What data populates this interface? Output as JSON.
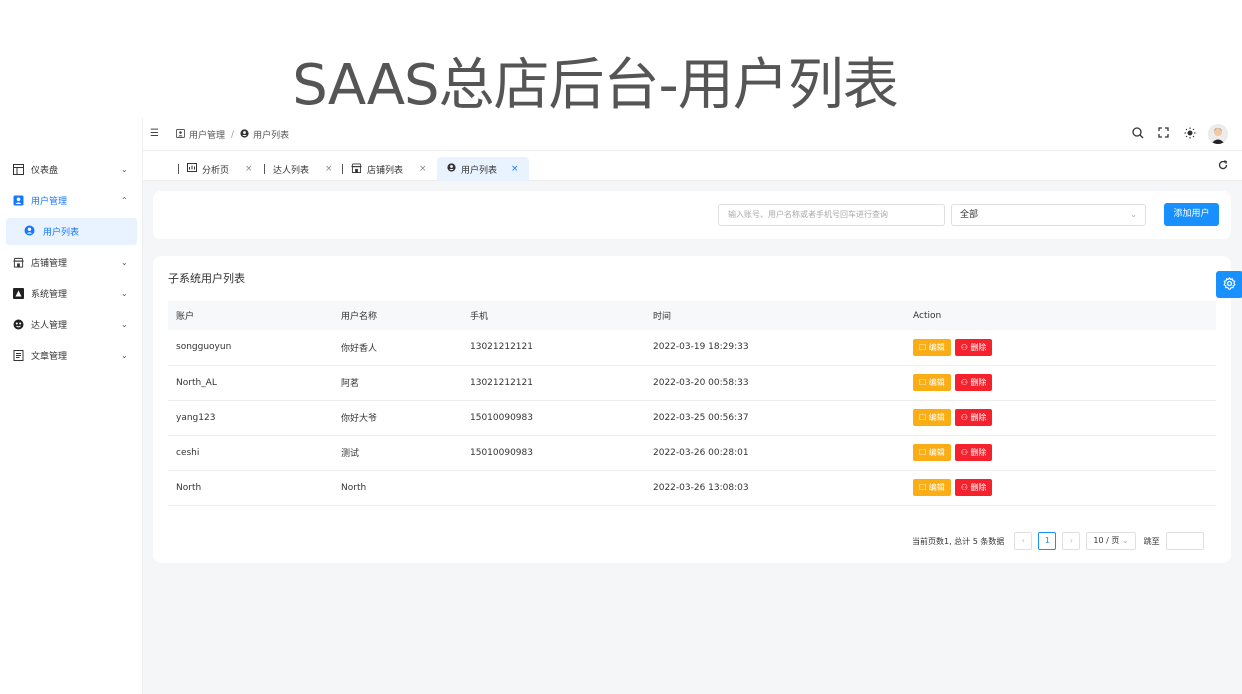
{
  "banner": {
    "title": "SAAS总店后台-用户列表"
  },
  "sidebar": {
    "items": [
      {
        "label": "仪表盘",
        "icon": "dashboard-icon"
      },
      {
        "label": "用户管理",
        "icon": "user-card-icon",
        "active": true
      },
      {
        "label": "店铺管理",
        "icon": "store-icon"
      },
      {
        "label": "系统管理",
        "icon": "system-icon"
      },
      {
        "label": "达人管理",
        "icon": "influencer-icon"
      },
      {
        "label": "文章管理",
        "icon": "article-icon"
      }
    ],
    "sub_item": {
      "label": "用户列表",
      "icon": "user-circle-icon"
    }
  },
  "breadcrumb": {
    "parent": "用户管理",
    "sep": "/",
    "current": "用户列表"
  },
  "tabs": [
    {
      "label": "分析页",
      "close": "×"
    },
    {
      "label": "达人列表",
      "close": "×"
    },
    {
      "label": "店铺列表",
      "close": "×"
    },
    {
      "label": "用户列表",
      "close": "×",
      "active": true
    }
  ],
  "search": {
    "placeholder": "输入账号、用户名称或者手机号回车进行查询",
    "select_value": "全部",
    "add_button": "添加用户"
  },
  "table": {
    "title": "子系统用户列表",
    "columns": [
      "账户",
      "用户名称",
      "手机",
      "时间",
      "Action"
    ],
    "rows": [
      {
        "account": "songguoyun",
        "name": "你好香人",
        "phone": "13021212121",
        "time": "2022-03-19 18:29:33"
      },
      {
        "account": "North_AL",
        "name": "阿茗",
        "phone": "13021212121",
        "time": "2022-03-20 00:58:33"
      },
      {
        "account": "yang123",
        "name": "你好大爷",
        "phone": "15010090983",
        "time": "2022-03-25 00:56:37"
      },
      {
        "account": "ceshi",
        "name": "测试",
        "phone": "15010090983",
        "time": "2022-03-26 00:28:01"
      },
      {
        "account": "North",
        "name": "North",
        "phone": "",
        "time": "2022-03-26 13:08:03"
      }
    ],
    "edit_label": "编辑",
    "delete_label": "删除"
  },
  "pagination": {
    "summary": "当前页数1, 总计 5 条数据",
    "prev": "‹",
    "current_page": "1",
    "next": "›",
    "page_size": "10 / 页",
    "jump_label": "跳至"
  },
  "colors": {
    "primary": "#1890ff",
    "edit": "#faad14",
    "delete": "#f5222d",
    "active_bg": "#e8f3ff"
  }
}
